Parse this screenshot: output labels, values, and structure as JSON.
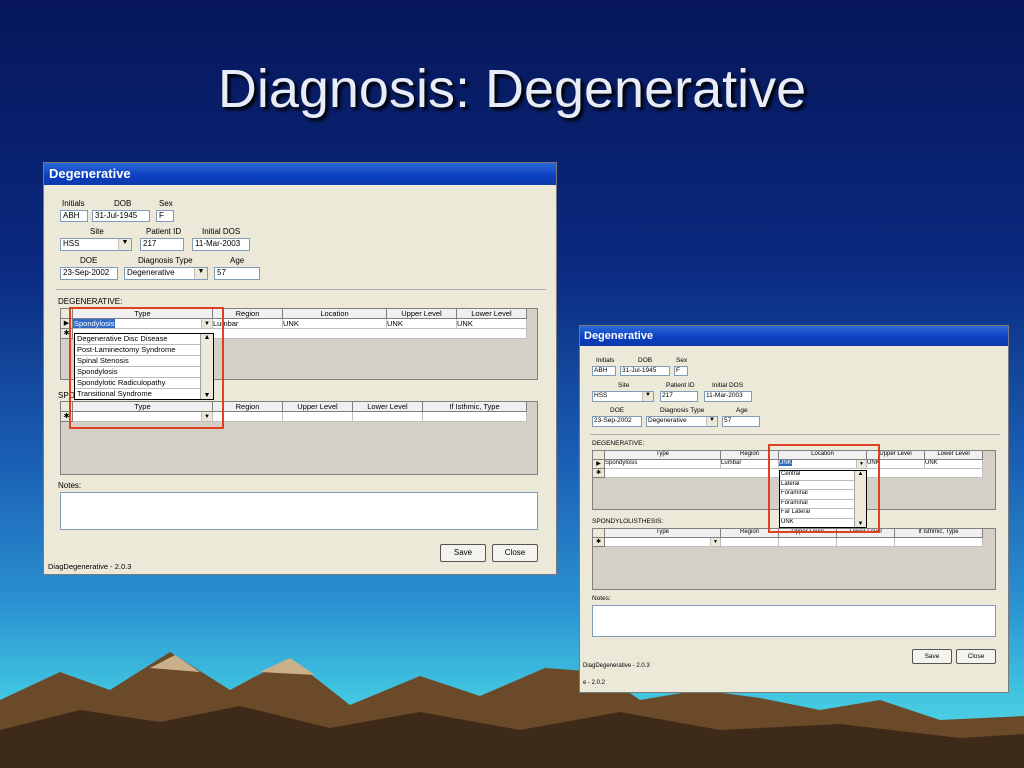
{
  "slide": {
    "title": "Diagnosis: Degenerative"
  },
  "window": {
    "title": "Degenerative",
    "labels": {
      "initials": "Initials",
      "dob": "DOB",
      "sex": "Sex",
      "site": "Site",
      "patient_id": "Patient ID",
      "initial_dos": "Initial DOS",
      "doe": "DOE",
      "diagnosis_type": "Diagnosis Type",
      "age": "Age"
    },
    "fields": {
      "initials": "ABH",
      "dob": "31-Jul-1945",
      "sex": "F",
      "site": "HSS",
      "patient_id": "217",
      "initial_dos": "11-Mar-2003",
      "doe": "23-Sep-2002",
      "diagnosis_type": "Degenerative",
      "age": "57"
    },
    "degenerative_section": "DEGENERATIVE:",
    "degen_headers": [
      "Type",
      "Region",
      "Location",
      "Upper Level",
      "Lower Level"
    ],
    "degen_row": {
      "type": "Spondylosis",
      "region": "Lumbar",
      "location": "UNK",
      "upper": "UNK",
      "lower": "UNK"
    },
    "spondy_section": "SPONDYLOLISTHESIS:",
    "spondy_headers": [
      "Type",
      "Region",
      "Upper Level",
      "Lower Level",
      "If Isthmic, Type"
    ],
    "notes_label": "Notes:",
    "save_label": "Save",
    "close_label": "Close",
    "status": "DiagDegenerative - 2.0.3",
    "type_options": [
      "Degenerative Disc Disease",
      "Post-Laminectomy Syndrome",
      "Spinal Stenosis",
      "Spondylosis",
      "Spondylotic Radiculopathy",
      "Transitional Syndrome"
    ],
    "location_options": [
      "Central",
      "Lateral",
      "Foraminal",
      "Foraminal",
      "Far Lateral",
      "UNK"
    ]
  },
  "colors": {
    "highlight": "#e04020",
    "selection": "#316ac5",
    "titlebar": "#0a3ec0"
  }
}
